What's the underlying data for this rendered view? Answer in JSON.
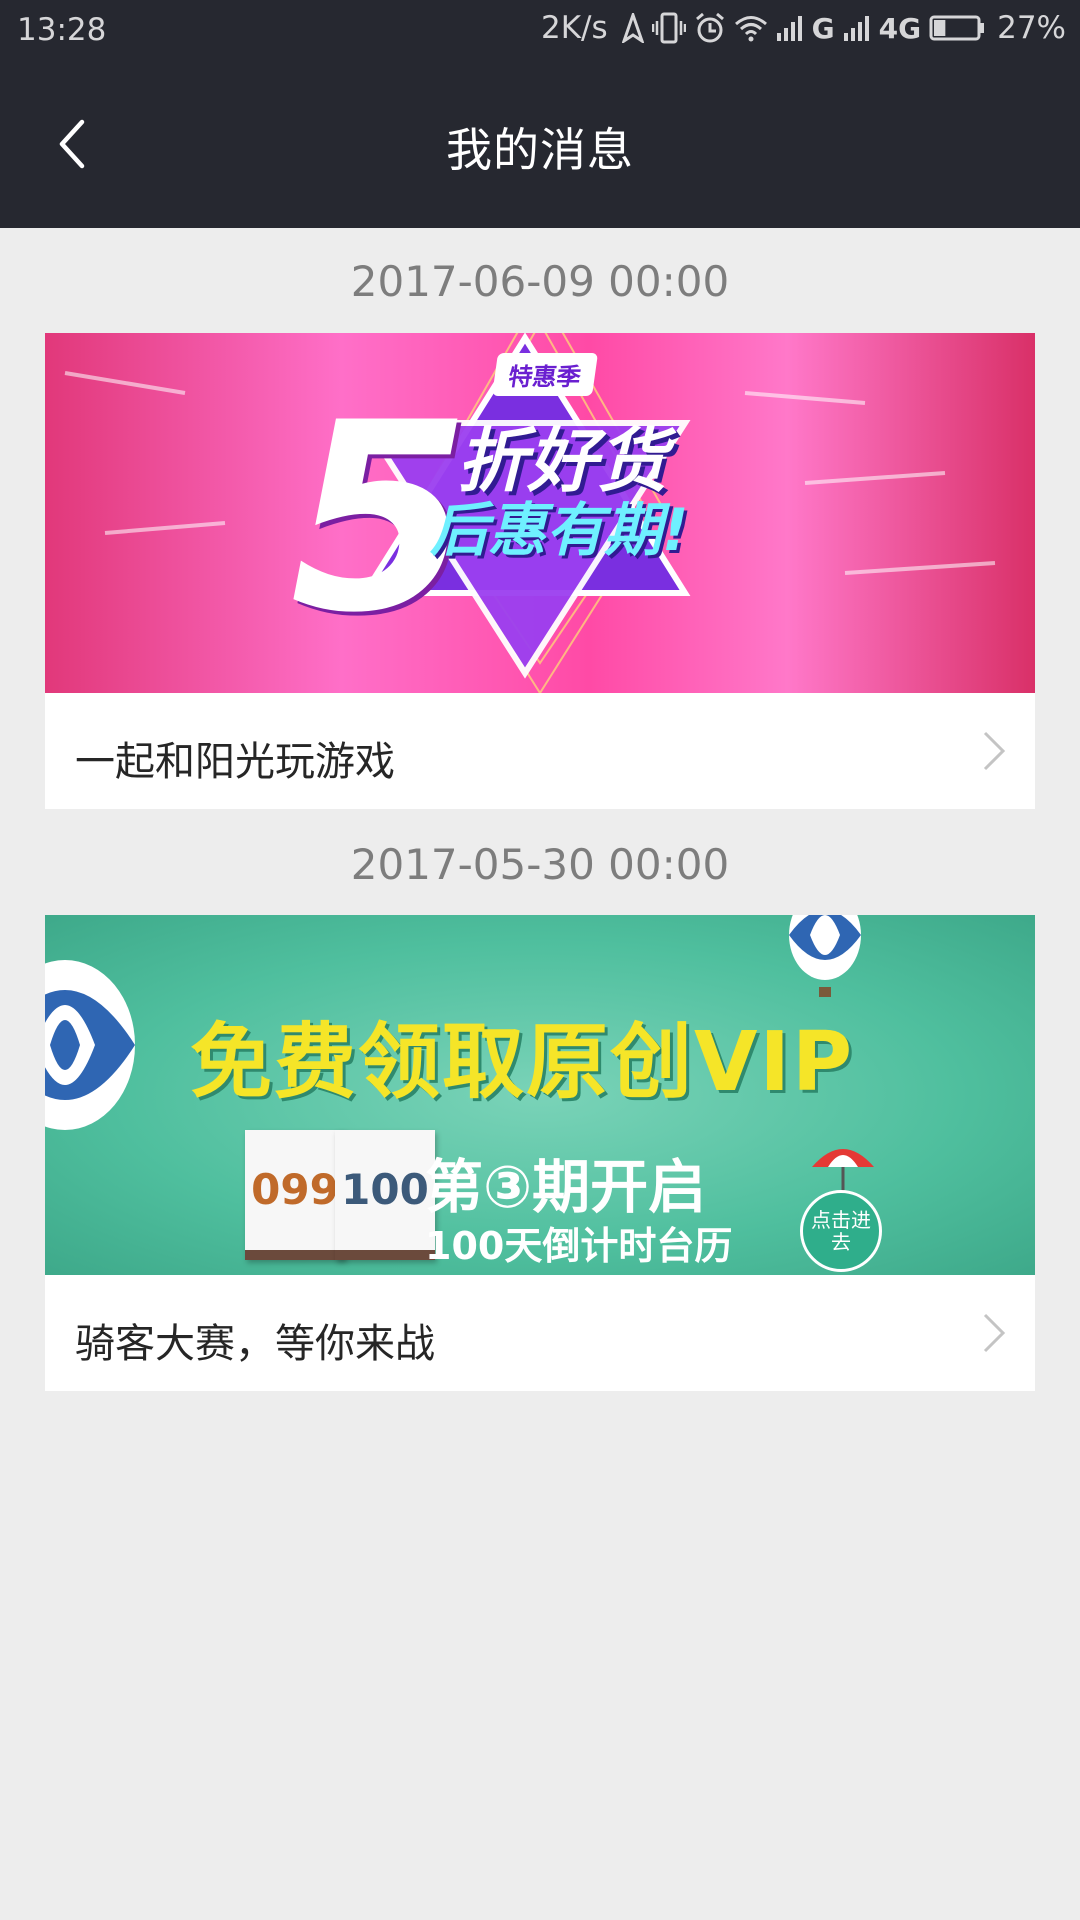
{
  "status_bar": {
    "time": "13:28",
    "speed": "2K/s",
    "signal_1_label": "G",
    "signal_2_label": "4G",
    "battery_percent": "27%",
    "battery_level": 0.27
  },
  "header": {
    "title": "我的消息",
    "back_icon": "back-arrow-icon"
  },
  "messages": [
    {
      "time": "2017-06-09 00:00",
      "title": "一起和阳光玩游戏",
      "banner": {
        "tag": "特惠季",
        "big_text": "5",
        "line1": "折好货",
        "line2": "后惠有期!"
      }
    },
    {
      "time": "2017-05-30 00:00",
      "title": "骑客大赛，等你来战",
      "banner": {
        "headline": "免费领取原创VIP",
        "sub1": "第③期开启",
        "sub2": "100天倒计时台历",
        "cal1": "099",
        "cal2": "100",
        "badge": "点击进去"
      }
    }
  ],
  "colors": {
    "header_bg": "#262830",
    "page_bg": "#ededed",
    "card_bg": "#ffffff"
  }
}
